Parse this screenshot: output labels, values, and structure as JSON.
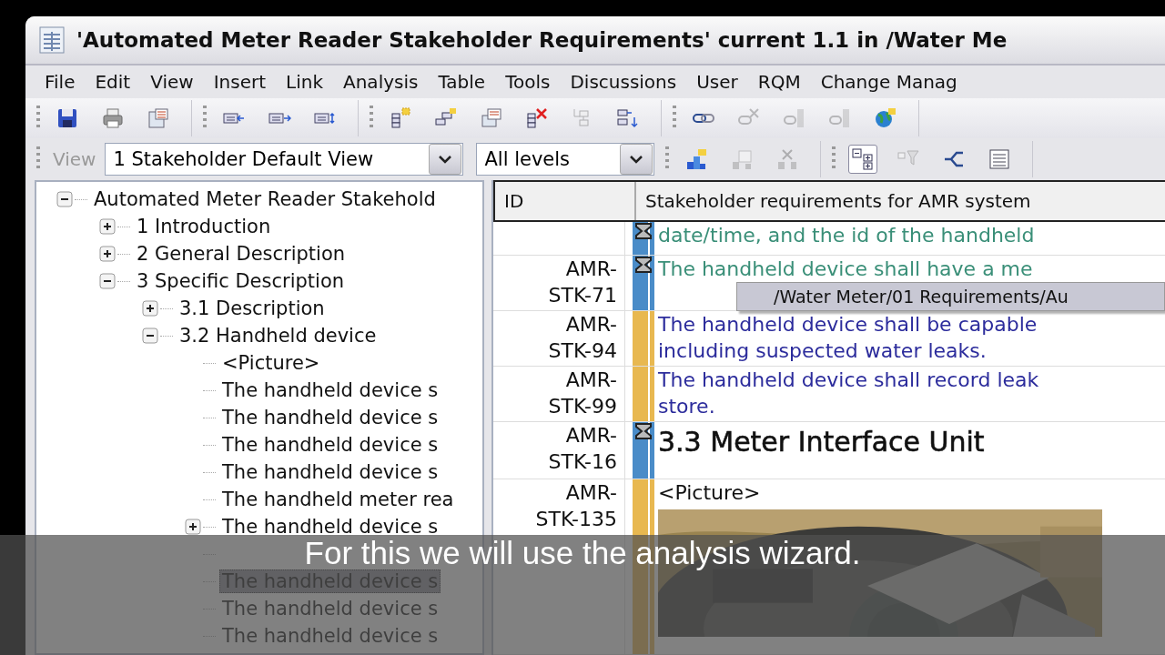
{
  "window": {
    "title": "'Automated Meter Reader Stakeholder Requirements' current 1.1 in /Water Me"
  },
  "menu": [
    "File",
    "Edit",
    "View",
    "Insert",
    "Link",
    "Analysis",
    "Table",
    "Tools",
    "Discussions",
    "User",
    "RQM",
    "Change Manag"
  ],
  "toolbar": [
    {
      "buttons": [
        {
          "disabled": false
        },
        {
          "disabled": false
        },
        {
          "disabled": false
        }
      ]
    },
    {
      "buttons": [
        {
          "disabled": false
        },
        {
          "disabled": false
        },
        {
          "disabled": false
        }
      ]
    },
    {
      "buttons": [
        {
          "disabled": false
        },
        {
          "disabled": false
        },
        {
          "disabled": false
        },
        {
          "disabled": false
        },
        {
          "disabled": true
        },
        {
          "disabled": false
        }
      ]
    },
    {
      "buttons": [
        {
          "disabled": false
        },
        {
          "disabled": true
        },
        {
          "disabled": true
        },
        {
          "disabled": true
        },
        {
          "disabled": false
        }
      ]
    }
  ],
  "view_bar": {
    "label": "View",
    "view": "1 Stakeholder Default View",
    "levels": "All levels",
    "tools": [
      {
        "buttons": [
          {
            "disabled": false,
            "pressed": false
          },
          {
            "disabled": true,
            "pressed": false
          },
          {
            "disabled": true,
            "pressed": false
          }
        ]
      },
      {
        "buttons": [
          {
            "disabled": false,
            "pressed": true
          },
          {
            "disabled": true,
            "pressed": false
          },
          {
            "disabled": false,
            "pressed": false
          },
          {
            "disabled": false,
            "pressed": false
          }
        ]
      }
    ]
  },
  "tree": [
    {
      "label": "Automated Meter Reader Stakehold",
      "expanded": true,
      "selected": false,
      "children": [
        {
          "label": "1 Introduction",
          "expanded": false,
          "selected": false
        },
        {
          "label": "2 General Description",
          "expanded": false,
          "selected": false
        },
        {
          "label": "3 Specific Description",
          "expanded": true,
          "selected": false,
          "children": [
            {
              "label": "3.1 Description",
              "expanded": false,
              "selected": false
            },
            {
              "label": "3.2 Handheld device",
              "expanded": true,
              "selected": false,
              "children": [
                {
                  "label": "<Picture>",
                  "selected": false
                },
                {
                  "label": "The handheld device s",
                  "selected": false
                },
                {
                  "label": "The handheld device s",
                  "selected": false
                },
                {
                  "label": "The handheld device s",
                  "selected": false
                },
                {
                  "label": "The handheld device s",
                  "selected": false
                },
                {
                  "label": "The handheld meter rea",
                  "selected": false
                },
                {
                  "label": "The handheld device s",
                  "expanded": false,
                  "selected": false
                },
                {
                  "covered": true,
                  "selected": false
                },
                {
                  "label": "The handheld device s",
                  "selected": true
                },
                {
                  "label": "The handheld device s",
                  "selected": false
                },
                {
                  "label": "The handheld device s",
                  "selected": false
                }
              ]
            }
          ]
        }
      ]
    }
  ],
  "table": {
    "columns": [
      "ID",
      "Stakeholder requirements for AMR system"
    ],
    "rows": [
      {
        "kind": "text",
        "bar": {
          "color": "#4a8cc8",
          "hourglass": true
        },
        "content": {
          "color": "#3a8f78",
          "lines": [
            "date/time, and the id of the handheld"
          ]
        }
      },
      {
        "kind": "text",
        "id": "AMR-STK-71",
        "bar": {
          "color": "#4a8cc8",
          "hourglass": true
        },
        "content": {
          "color": "#3a8f78",
          "lines": [
            "The handheld device shall have a me"
          ]
        }
      },
      {
        "kind": "text",
        "id": "AMR-STK-94",
        "bar": {
          "color": "#e8b850",
          "hourglass": false
        },
        "content": {
          "color": "#2c2c9c",
          "lines": [
            "The handheld device shall be capable",
            "including suspected water leaks."
          ]
        }
      },
      {
        "kind": "text",
        "id": "AMR-STK-99",
        "bar": {
          "color": "#e8b850",
          "hourglass": false
        },
        "content": {
          "color": "#2c2c9c",
          "lines": [
            "The handheld device shall record leak",
            "store."
          ]
        }
      },
      {
        "kind": "heading",
        "id": "AMR-STK-16",
        "bar": {
          "color": "#4a8cc8",
          "hourglass": true
        },
        "content": {
          "color": "#111111",
          "lines": [
            "3.3 Meter Interface Unit"
          ]
        }
      },
      {
        "kind": "picture",
        "id": "AMR-STK-135",
        "bar": {
          "color": "#e8b850",
          "hourglass": false
        },
        "content": {
          "color": "#111111",
          "lines": [
            "<Picture>"
          ]
        }
      }
    ]
  },
  "tooltip": "/Water Meter/01 Requirements/Au",
  "caption": "For this we will use the analysis wizard."
}
